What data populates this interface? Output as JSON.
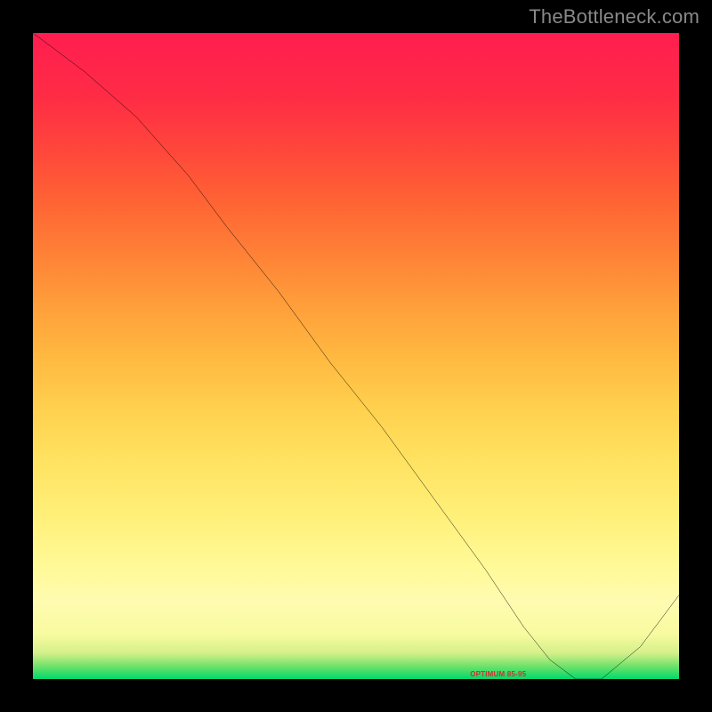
{
  "watermark": "TheBottleneck.com",
  "tiny_marker_label": "OPTIMUM 85-95",
  "chart_data": {
    "type": "line",
    "title": "",
    "xlabel": "",
    "ylabel": "",
    "xlim": [
      0,
      100
    ],
    "ylim": [
      0,
      100
    ],
    "x": [
      0,
      8,
      16,
      24,
      30,
      38,
      46,
      54,
      62,
      70,
      76,
      80,
      84,
      88,
      94,
      100
    ],
    "y": [
      100,
      94,
      87,
      78,
      70,
      60,
      49,
      39,
      28,
      17,
      8,
      3,
      0,
      0,
      5,
      13
    ],
    "background_gradient": {
      "direction": "vertical",
      "stops": [
        {
          "pos": 0.0,
          "color": "#00d96b"
        },
        {
          "pos": 0.07,
          "color": "#f8fba0"
        },
        {
          "pos": 0.17,
          "color": "#fffa99"
        },
        {
          "pos": 0.34,
          "color": "#ffe260"
        },
        {
          "pos": 0.58,
          "color": "#ff9e3a"
        },
        {
          "pos": 0.82,
          "color": "#ff463b"
        },
        {
          "pos": 1.0,
          "color": "#ff1e4f"
        }
      ]
    },
    "annotations": [
      {
        "text": "OPTIMUM 85-95",
        "x": 86,
        "y": 0,
        "color": "#d03030"
      }
    ]
  }
}
